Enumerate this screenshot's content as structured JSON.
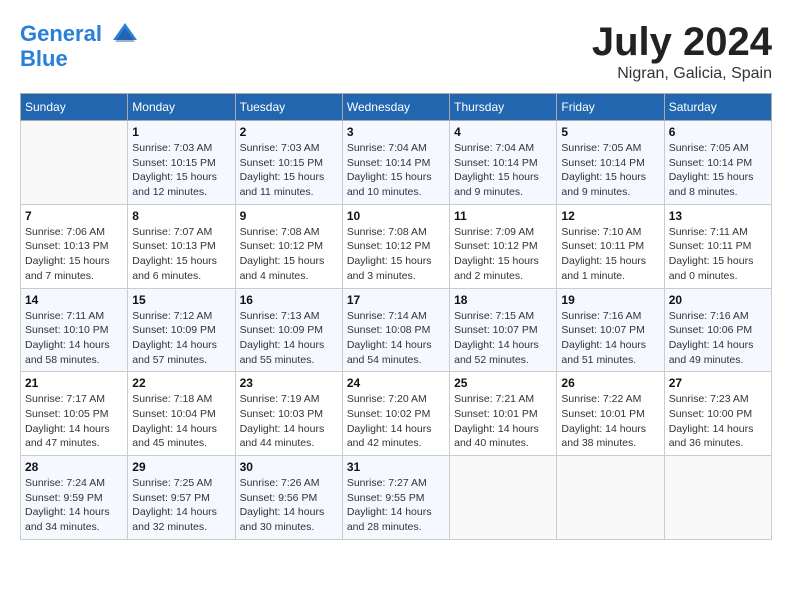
{
  "header": {
    "logo_line1": "General",
    "logo_line2": "Blue",
    "month_year": "July 2024",
    "location": "Nigran, Galicia, Spain"
  },
  "weekdays": [
    "Sunday",
    "Monday",
    "Tuesday",
    "Wednesday",
    "Thursday",
    "Friday",
    "Saturday"
  ],
  "weeks": [
    [
      {
        "day": "",
        "sunrise": "",
        "sunset": "",
        "daylight": ""
      },
      {
        "day": "1",
        "sunrise": "Sunrise: 7:03 AM",
        "sunset": "Sunset: 10:15 PM",
        "daylight": "Daylight: 15 hours and 12 minutes."
      },
      {
        "day": "2",
        "sunrise": "Sunrise: 7:03 AM",
        "sunset": "Sunset: 10:15 PM",
        "daylight": "Daylight: 15 hours and 11 minutes."
      },
      {
        "day": "3",
        "sunrise": "Sunrise: 7:04 AM",
        "sunset": "Sunset: 10:14 PM",
        "daylight": "Daylight: 15 hours and 10 minutes."
      },
      {
        "day": "4",
        "sunrise": "Sunrise: 7:04 AM",
        "sunset": "Sunset: 10:14 PM",
        "daylight": "Daylight: 15 hours and 9 minutes."
      },
      {
        "day": "5",
        "sunrise": "Sunrise: 7:05 AM",
        "sunset": "Sunset: 10:14 PM",
        "daylight": "Daylight: 15 hours and 9 minutes."
      },
      {
        "day": "6",
        "sunrise": "Sunrise: 7:05 AM",
        "sunset": "Sunset: 10:14 PM",
        "daylight": "Daylight: 15 hours and 8 minutes."
      }
    ],
    [
      {
        "day": "7",
        "sunrise": "Sunrise: 7:06 AM",
        "sunset": "Sunset: 10:13 PM",
        "daylight": "Daylight: 15 hours and 7 minutes."
      },
      {
        "day": "8",
        "sunrise": "Sunrise: 7:07 AM",
        "sunset": "Sunset: 10:13 PM",
        "daylight": "Daylight: 15 hours and 6 minutes."
      },
      {
        "day": "9",
        "sunrise": "Sunrise: 7:08 AM",
        "sunset": "Sunset: 10:12 PM",
        "daylight": "Daylight: 15 hours and 4 minutes."
      },
      {
        "day": "10",
        "sunrise": "Sunrise: 7:08 AM",
        "sunset": "Sunset: 10:12 PM",
        "daylight": "Daylight: 15 hours and 3 minutes."
      },
      {
        "day": "11",
        "sunrise": "Sunrise: 7:09 AM",
        "sunset": "Sunset: 10:12 PM",
        "daylight": "Daylight: 15 hours and 2 minutes."
      },
      {
        "day": "12",
        "sunrise": "Sunrise: 7:10 AM",
        "sunset": "Sunset: 10:11 PM",
        "daylight": "Daylight: 15 hours and 1 minute."
      },
      {
        "day": "13",
        "sunrise": "Sunrise: 7:11 AM",
        "sunset": "Sunset: 10:11 PM",
        "daylight": "Daylight: 15 hours and 0 minutes."
      }
    ],
    [
      {
        "day": "14",
        "sunrise": "Sunrise: 7:11 AM",
        "sunset": "Sunset: 10:10 PM",
        "daylight": "Daylight: 14 hours and 58 minutes."
      },
      {
        "day": "15",
        "sunrise": "Sunrise: 7:12 AM",
        "sunset": "Sunset: 10:09 PM",
        "daylight": "Daylight: 14 hours and 57 minutes."
      },
      {
        "day": "16",
        "sunrise": "Sunrise: 7:13 AM",
        "sunset": "Sunset: 10:09 PM",
        "daylight": "Daylight: 14 hours and 55 minutes."
      },
      {
        "day": "17",
        "sunrise": "Sunrise: 7:14 AM",
        "sunset": "Sunset: 10:08 PM",
        "daylight": "Daylight: 14 hours and 54 minutes."
      },
      {
        "day": "18",
        "sunrise": "Sunrise: 7:15 AM",
        "sunset": "Sunset: 10:07 PM",
        "daylight": "Daylight: 14 hours and 52 minutes."
      },
      {
        "day": "19",
        "sunrise": "Sunrise: 7:16 AM",
        "sunset": "Sunset: 10:07 PM",
        "daylight": "Daylight: 14 hours and 51 minutes."
      },
      {
        "day": "20",
        "sunrise": "Sunrise: 7:16 AM",
        "sunset": "Sunset: 10:06 PM",
        "daylight": "Daylight: 14 hours and 49 minutes."
      }
    ],
    [
      {
        "day": "21",
        "sunrise": "Sunrise: 7:17 AM",
        "sunset": "Sunset: 10:05 PM",
        "daylight": "Daylight: 14 hours and 47 minutes."
      },
      {
        "day": "22",
        "sunrise": "Sunrise: 7:18 AM",
        "sunset": "Sunset: 10:04 PM",
        "daylight": "Daylight: 14 hours and 45 minutes."
      },
      {
        "day": "23",
        "sunrise": "Sunrise: 7:19 AM",
        "sunset": "Sunset: 10:03 PM",
        "daylight": "Daylight: 14 hours and 44 minutes."
      },
      {
        "day": "24",
        "sunrise": "Sunrise: 7:20 AM",
        "sunset": "Sunset: 10:02 PM",
        "daylight": "Daylight: 14 hours and 42 minutes."
      },
      {
        "day": "25",
        "sunrise": "Sunrise: 7:21 AM",
        "sunset": "Sunset: 10:01 PM",
        "daylight": "Daylight: 14 hours and 40 minutes."
      },
      {
        "day": "26",
        "sunrise": "Sunrise: 7:22 AM",
        "sunset": "Sunset: 10:01 PM",
        "daylight": "Daylight: 14 hours and 38 minutes."
      },
      {
        "day": "27",
        "sunrise": "Sunrise: 7:23 AM",
        "sunset": "Sunset: 10:00 PM",
        "daylight": "Daylight: 14 hours and 36 minutes."
      }
    ],
    [
      {
        "day": "28",
        "sunrise": "Sunrise: 7:24 AM",
        "sunset": "Sunset: 9:59 PM",
        "daylight": "Daylight: 14 hours and 34 minutes."
      },
      {
        "day": "29",
        "sunrise": "Sunrise: 7:25 AM",
        "sunset": "Sunset: 9:57 PM",
        "daylight": "Daylight: 14 hours and 32 minutes."
      },
      {
        "day": "30",
        "sunrise": "Sunrise: 7:26 AM",
        "sunset": "Sunset: 9:56 PM",
        "daylight": "Daylight: 14 hours and 30 minutes."
      },
      {
        "day": "31",
        "sunrise": "Sunrise: 7:27 AM",
        "sunset": "Sunset: 9:55 PM",
        "daylight": "Daylight: 14 hours and 28 minutes."
      },
      {
        "day": "",
        "sunrise": "",
        "sunset": "",
        "daylight": ""
      },
      {
        "day": "",
        "sunrise": "",
        "sunset": "",
        "daylight": ""
      },
      {
        "day": "",
        "sunrise": "",
        "sunset": "",
        "daylight": ""
      }
    ]
  ]
}
